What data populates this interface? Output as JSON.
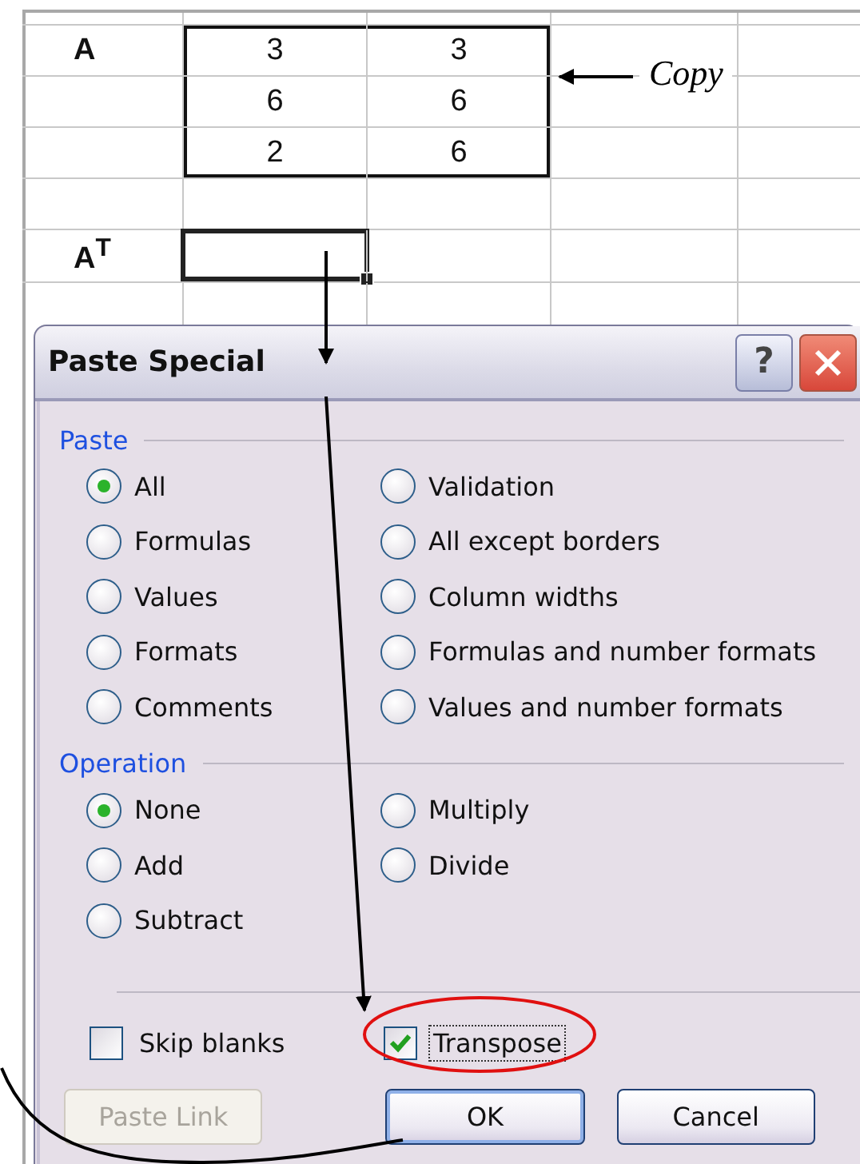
{
  "sheet": {
    "matrix_label": "A",
    "matrix": [
      [
        "3",
        "3"
      ],
      [
        "6",
        "6"
      ],
      [
        "2",
        "6"
      ]
    ],
    "result_label": "A$^{T}$",
    "result_selected": true
  },
  "annotation": {
    "label": "Copy"
  },
  "dialog": {
    "title": "Paste Special",
    "help_button": "?",
    "groups": [
      {
        "label": "Paste",
        "options": [
          {
            "label": "All",
            "selected": true
          },
          {
            "label": "Validation",
            "selected": false
          },
          {
            "label": "Formulas",
            "selected": false
          },
          {
            "label": "All except borders",
            "selected": false
          },
          {
            "label": "Values",
            "selected": false
          },
          {
            "label": "Column widths",
            "selected": false
          },
          {
            "label": "Formats",
            "selected": false
          },
          {
            "label": "Formulas and number formats",
            "selected": false
          },
          {
            "label": "Comments",
            "selected": false
          },
          {
            "label": "Values and number formats",
            "selected": false
          }
        ]
      },
      {
        "label": "Operation",
        "options": [
          {
            "label": "None",
            "selected": true
          },
          {
            "label": "Multiply",
            "selected": false
          },
          {
            "label": "Add",
            "selected": false
          },
          {
            "label": "Divide",
            "selected": false
          },
          {
            "label": "Subtract",
            "selected": false
          }
        ]
      }
    ],
    "checkboxes": [
      {
        "label": "Skip blanks",
        "checked": false,
        "focused": false
      },
      {
        "label": "Transpose",
        "checked": true,
        "focused": true
      }
    ],
    "buttons": [
      {
        "label": "Paste Link",
        "disabled": true,
        "default": false
      },
      {
        "label": "OK",
        "disabled": false,
        "default": true
      },
      {
        "label": "Cancel",
        "disabled": false,
        "default": false
      }
    ]
  }
}
